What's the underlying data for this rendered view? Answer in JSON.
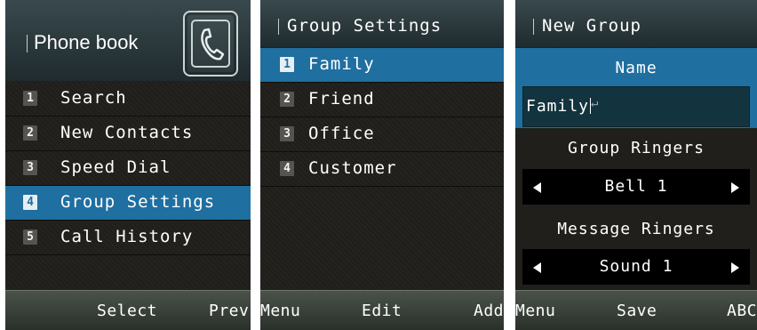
{
  "phonebook": {
    "title": "Phone book",
    "icon": "phone-contact-icon",
    "items": [
      {
        "num": "1",
        "label": "Search"
      },
      {
        "num": "2",
        "label": "New Contacts"
      },
      {
        "num": "3",
        "label": "Speed Dial"
      },
      {
        "num": "4",
        "label": "Group Settings"
      },
      {
        "num": "5",
        "label": "Call History"
      }
    ],
    "selected_index": 3,
    "softkeys": {
      "center": "Select",
      "right": "Prev"
    }
  },
  "group_settings": {
    "title": "Group Settings",
    "items": [
      {
        "num": "1",
        "label": "Family"
      },
      {
        "num": "2",
        "label": "Friend"
      },
      {
        "num": "3",
        "label": "Office"
      },
      {
        "num": "4",
        "label": "Customer"
      }
    ],
    "selected_index": 0,
    "softkeys": {
      "left": "Menu",
      "center": "Edit",
      "right": "Add"
    }
  },
  "new_group": {
    "title": "New Group",
    "name_label": "Name",
    "name_value": "Family",
    "group_ringers_label": "Group Ringers",
    "group_ringer_value": "Bell 1",
    "message_ringers_label": "Message Ringers",
    "message_ringer_value": "Sound 1",
    "softkeys": {
      "left": "Menu",
      "center": "Save",
      "right": "ABC"
    }
  },
  "colors": {
    "selection": "#1f6fa0",
    "background": "#201f1b",
    "header": "#2f3e42"
  }
}
